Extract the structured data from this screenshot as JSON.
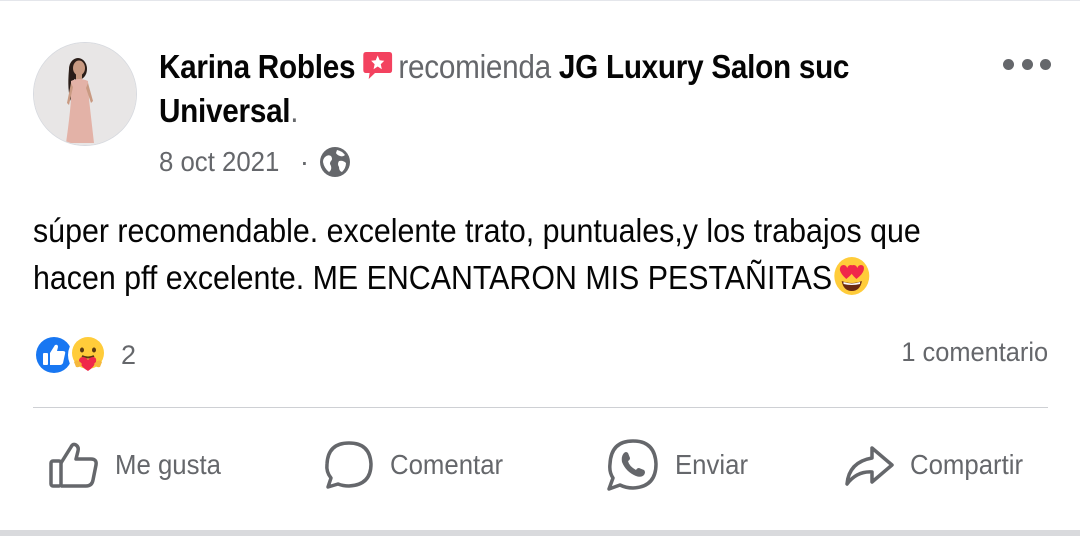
{
  "post": {
    "author": "Karina Robles",
    "verb": "recomienda",
    "page_name": "JG Luxury Salon suc Universal",
    "period": ".",
    "date": "8 oct 2021",
    "separator": "·",
    "body": "súper recomendable. excelente trato, puntuales,y los trabajos que hacen pff excelente. ME ENCANTARON MIS PESTAÑITAS",
    "body_emoji": "heart-eyes-emoji"
  },
  "reactions": {
    "icons": [
      "like-reaction-icon",
      "care-reaction-icon"
    ],
    "count": "2",
    "comments": "1 comentario"
  },
  "actions": {
    "like": "Me gusta",
    "comment": "Comentar",
    "send": "Enviar",
    "share": "Compartir"
  },
  "colors": {
    "primary_text": "#050505",
    "secondary_text": "#65676b",
    "like_blue": "#1877f2",
    "recommend_badge": "#f3425f",
    "divider": "#ced0d4"
  }
}
